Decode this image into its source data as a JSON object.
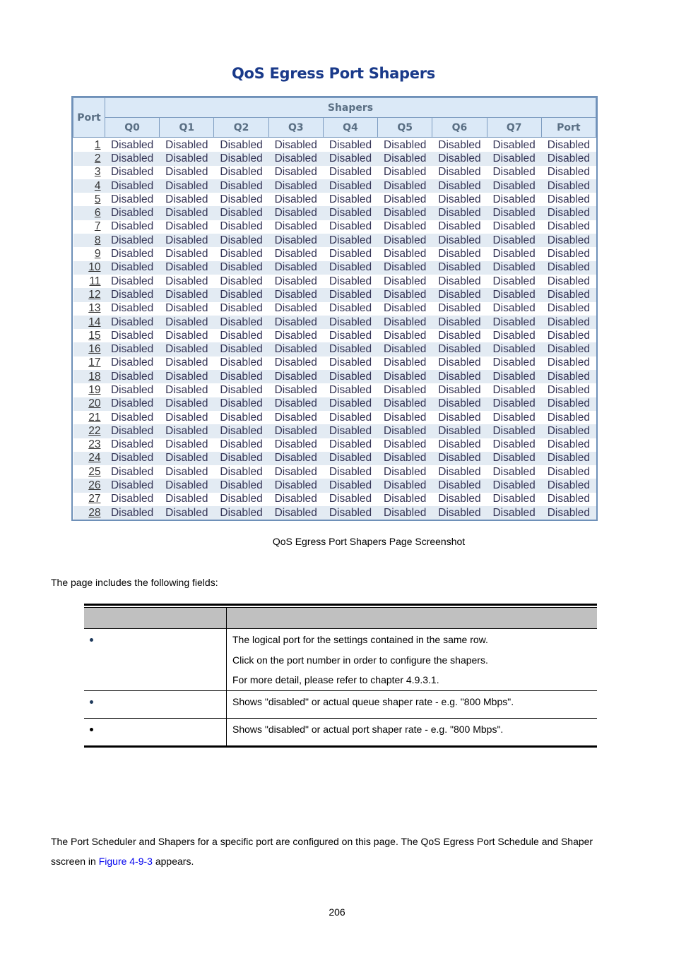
{
  "screenshot": {
    "title": "QoS Egress Port Shapers",
    "header": {
      "port_label": "Port",
      "group_label": "Shapers",
      "columns": [
        "Q0",
        "Q1",
        "Q2",
        "Q3",
        "Q4",
        "Q5",
        "Q6",
        "Q7",
        "Port"
      ]
    },
    "rows": [
      {
        "port": "1",
        "values": [
          "Disabled",
          "Disabled",
          "Disabled",
          "Disabled",
          "Disabled",
          "Disabled",
          "Disabled",
          "Disabled",
          "Disabled"
        ]
      },
      {
        "port": "2",
        "values": [
          "Disabled",
          "Disabled",
          "Disabled",
          "Disabled",
          "Disabled",
          "Disabled",
          "Disabled",
          "Disabled",
          "Disabled"
        ]
      },
      {
        "port": "3",
        "values": [
          "Disabled",
          "Disabled",
          "Disabled",
          "Disabled",
          "Disabled",
          "Disabled",
          "Disabled",
          "Disabled",
          "Disabled"
        ]
      },
      {
        "port": "4",
        "values": [
          "Disabled",
          "Disabled",
          "Disabled",
          "Disabled",
          "Disabled",
          "Disabled",
          "Disabled",
          "Disabled",
          "Disabled"
        ]
      },
      {
        "port": "5",
        "values": [
          "Disabled",
          "Disabled",
          "Disabled",
          "Disabled",
          "Disabled",
          "Disabled",
          "Disabled",
          "Disabled",
          "Disabled"
        ]
      },
      {
        "port": "6",
        "values": [
          "Disabled",
          "Disabled",
          "Disabled",
          "Disabled",
          "Disabled",
          "Disabled",
          "Disabled",
          "Disabled",
          "Disabled"
        ]
      },
      {
        "port": "7",
        "values": [
          "Disabled",
          "Disabled",
          "Disabled",
          "Disabled",
          "Disabled",
          "Disabled",
          "Disabled",
          "Disabled",
          "Disabled"
        ]
      },
      {
        "port": "8",
        "values": [
          "Disabled",
          "Disabled",
          "Disabled",
          "Disabled",
          "Disabled",
          "Disabled",
          "Disabled",
          "Disabled",
          "Disabled"
        ]
      },
      {
        "port": "9",
        "values": [
          "Disabled",
          "Disabled",
          "Disabled",
          "Disabled",
          "Disabled",
          "Disabled",
          "Disabled",
          "Disabled",
          "Disabled"
        ]
      },
      {
        "port": "10",
        "values": [
          "Disabled",
          "Disabled",
          "Disabled",
          "Disabled",
          "Disabled",
          "Disabled",
          "Disabled",
          "Disabled",
          "Disabled"
        ]
      },
      {
        "port": "11",
        "values": [
          "Disabled",
          "Disabled",
          "Disabled",
          "Disabled",
          "Disabled",
          "Disabled",
          "Disabled",
          "Disabled",
          "Disabled"
        ]
      },
      {
        "port": "12",
        "values": [
          "Disabled",
          "Disabled",
          "Disabled",
          "Disabled",
          "Disabled",
          "Disabled",
          "Disabled",
          "Disabled",
          "Disabled"
        ]
      },
      {
        "port": "13",
        "values": [
          "Disabled",
          "Disabled",
          "Disabled",
          "Disabled",
          "Disabled",
          "Disabled",
          "Disabled",
          "Disabled",
          "Disabled"
        ]
      },
      {
        "port": "14",
        "values": [
          "Disabled",
          "Disabled",
          "Disabled",
          "Disabled",
          "Disabled",
          "Disabled",
          "Disabled",
          "Disabled",
          "Disabled"
        ]
      },
      {
        "port": "15",
        "values": [
          "Disabled",
          "Disabled",
          "Disabled",
          "Disabled",
          "Disabled",
          "Disabled",
          "Disabled",
          "Disabled",
          "Disabled"
        ]
      },
      {
        "port": "16",
        "values": [
          "Disabled",
          "Disabled",
          "Disabled",
          "Disabled",
          "Disabled",
          "Disabled",
          "Disabled",
          "Disabled",
          "Disabled"
        ]
      },
      {
        "port": "17",
        "values": [
          "Disabled",
          "Disabled",
          "Disabled",
          "Disabled",
          "Disabled",
          "Disabled",
          "Disabled",
          "Disabled",
          "Disabled"
        ]
      },
      {
        "port": "18",
        "values": [
          "Disabled",
          "Disabled",
          "Disabled",
          "Disabled",
          "Disabled",
          "Disabled",
          "Disabled",
          "Disabled",
          "Disabled"
        ]
      },
      {
        "port": "19",
        "values": [
          "Disabled",
          "Disabled",
          "Disabled",
          "Disabled",
          "Disabled",
          "Disabled",
          "Disabled",
          "Disabled",
          "Disabled"
        ]
      },
      {
        "port": "20",
        "values": [
          "Disabled",
          "Disabled",
          "Disabled",
          "Disabled",
          "Disabled",
          "Disabled",
          "Disabled",
          "Disabled",
          "Disabled"
        ]
      },
      {
        "port": "21",
        "values": [
          "Disabled",
          "Disabled",
          "Disabled",
          "Disabled",
          "Disabled",
          "Disabled",
          "Disabled",
          "Disabled",
          "Disabled"
        ]
      },
      {
        "port": "22",
        "values": [
          "Disabled",
          "Disabled",
          "Disabled",
          "Disabled",
          "Disabled",
          "Disabled",
          "Disabled",
          "Disabled",
          "Disabled"
        ]
      },
      {
        "port": "23",
        "values": [
          "Disabled",
          "Disabled",
          "Disabled",
          "Disabled",
          "Disabled",
          "Disabled",
          "Disabled",
          "Disabled",
          "Disabled"
        ]
      },
      {
        "port": "24",
        "values": [
          "Disabled",
          "Disabled",
          "Disabled",
          "Disabled",
          "Disabled",
          "Disabled",
          "Disabled",
          "Disabled",
          "Disabled"
        ]
      },
      {
        "port": "25",
        "values": [
          "Disabled",
          "Disabled",
          "Disabled",
          "Disabled",
          "Disabled",
          "Disabled",
          "Disabled",
          "Disabled",
          "Disabled"
        ]
      },
      {
        "port": "26",
        "values": [
          "Disabled",
          "Disabled",
          "Disabled",
          "Disabled",
          "Disabled",
          "Disabled",
          "Disabled",
          "Disabled",
          "Disabled"
        ]
      },
      {
        "port": "27",
        "values": [
          "Disabled",
          "Disabled",
          "Disabled",
          "Disabled",
          "Disabled",
          "Disabled",
          "Disabled",
          "Disabled",
          "Disabled"
        ]
      },
      {
        "port": "28",
        "values": [
          "Disabled",
          "Disabled",
          "Disabled",
          "Disabled",
          "Disabled",
          "Disabled",
          "Disabled",
          "Disabled",
          "Disabled"
        ]
      }
    ]
  },
  "caption": "QoS Egress Port Shapers Page Screenshot",
  "intro": "The page includes the following fields:",
  "fields_table": {
    "header": [
      "",
      ""
    ],
    "rows": [
      {
        "object": "",
        "bullet": "bullet-icon",
        "description": [
          "The logical port for the settings contained in the same row.",
          "Click on the port number in order to configure the shapers.",
          "For more detail, please refer to chapter 4.9.3.1."
        ]
      },
      {
        "object": "",
        "bullet": "bullet-icon",
        "description": [
          "Shows \"disabled\" or actual queue shaper rate - e.g. \"800 Mbps\"."
        ]
      },
      {
        "object": "",
        "bullet": "bullet-icon",
        "description": [
          "Shows \"disabled\" or actual port shaper rate - e.g. \"800 Mbps\"."
        ]
      }
    ]
  },
  "paragraph": {
    "before": "The Port Scheduler and Shapers for a specific port are configured on this page. The QoS Egress Port Schedule and Shaper sscreen in ",
    "link": "Figure 4-9-3",
    "after": " appears."
  },
  "page_number": "206",
  "colors": {
    "title": "#1a3a8a",
    "header_bg": "#dbe9f7",
    "row_alt_bg": "#e3ebf3",
    "table_border": "#6e90b8",
    "link": "#0000ee",
    "fields_header_bg": "#c0c0c0"
  }
}
